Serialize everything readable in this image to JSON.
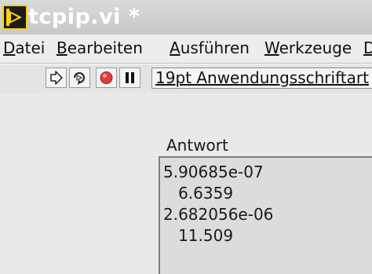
{
  "window": {
    "title": "tcpip.vi *",
    "icon": "labview-run-icon"
  },
  "menubar": {
    "items": [
      {
        "label": "Datei",
        "accelerator_index": 0
      },
      {
        "label": "Bearbeiten",
        "accelerator_index": 0
      },
      {
        "label": "Ausführen",
        "accelerator_index": 0
      },
      {
        "label": "Werkzeuge",
        "accelerator_index": 0
      },
      {
        "label": "D",
        "accelerator_index": 0
      }
    ]
  },
  "toolbar": {
    "buttons": [
      {
        "name": "run-arrow-icon"
      },
      {
        "name": "run-continuously-icon"
      },
      {
        "name": "abort-icon"
      },
      {
        "name": "pause-icon"
      }
    ],
    "font_selector": "19pt Anwendungsschriftart"
  },
  "front_panel": {
    "indicator": {
      "label": "Antwort",
      "lines": [
        "5.90685e-07",
        "   6.6359",
        "2.682056e-06",
        "   11.509"
      ]
    }
  },
  "colors": {
    "titlebar": "#c8c8c8",
    "abort_red": "#e23b3b",
    "canvas": "#e9e9e9",
    "icon_yellow": "#ffd200"
  }
}
